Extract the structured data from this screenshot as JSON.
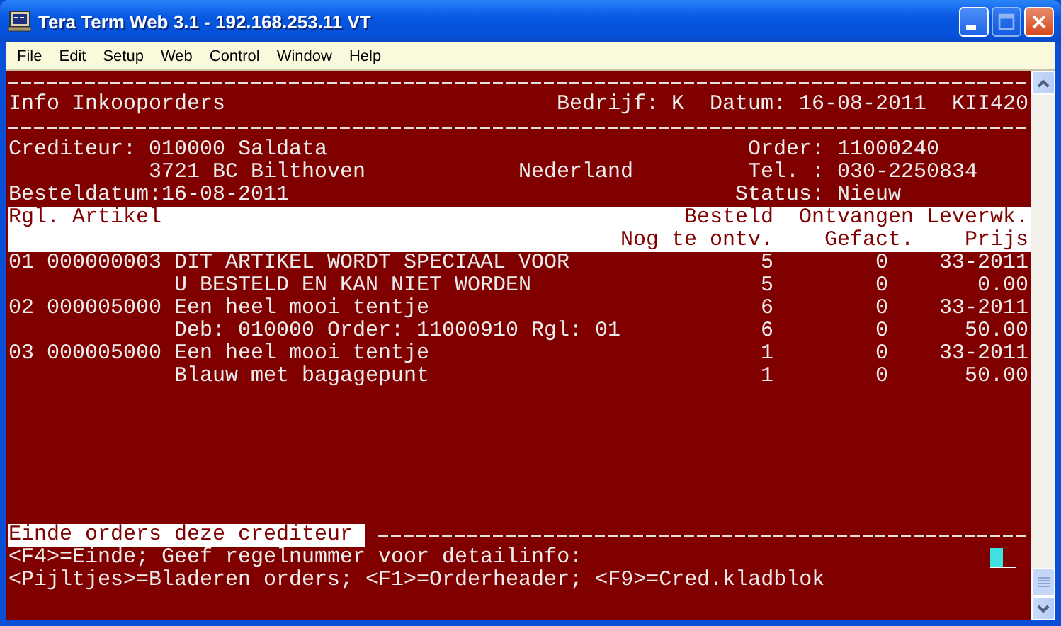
{
  "window": {
    "title": "Tera Term Web 3.1 - 192.168.253.11 VT"
  },
  "menu": [
    "File",
    "Edit",
    "Setup",
    "Web",
    "Control",
    "Window",
    "Help"
  ],
  "terminal": {
    "header": {
      "title": "Info Inkooporders",
      "company_label": "Bedrijf:",
      "company": "K",
      "date_label": "Datum:",
      "date": "16-08-2011",
      "program": "KII420"
    },
    "supplier": {
      "label": "Crediteur:",
      "name": "010000 Saldata",
      "address": "3721 BC Bilthoven",
      "country": "Nederland",
      "order_label": "Order:",
      "order": "11000240",
      "phone_label": "Tel. :",
      "phone": "030-2250834",
      "order_date_label": "Besteldatum:",
      "order_date": "16-08-2011",
      "status_label": "Status:",
      "status": "Nieuw"
    },
    "columns": {
      "line": "Rgl.",
      "article": "Artikel",
      "ordered": "Besteld",
      "received": "Ontvangen",
      "delivery_week": "Leverwk.",
      "outstanding": "Nog te ontv.",
      "invoiced": "Gefact.",
      "price": "Prijs"
    },
    "lines": [
      {
        "line": "01",
        "article": "000000003",
        "description": "DIT ARTIKEL WORDT SPECIAAL VOOR",
        "ordered": "5",
        "received": "0",
        "delivery_week": "33-2011",
        "description_2": "U BESTELD EN KAN NIET WORDEN",
        "outstanding": "5",
        "invoiced": "0",
        "price": "0.00"
      },
      {
        "line": "02",
        "article": "000005000",
        "description": "Een heel mooi tentje",
        "ordered": "6",
        "received": "0",
        "delivery_week": "33-2011",
        "description_2": "Deb: 010000 Order: 11000910 Rgl: 01",
        "outstanding": "6",
        "invoiced": "0",
        "price": "50.00"
      },
      {
        "line": "03",
        "article": "000005000",
        "description": "Een heel mooi tentje",
        "ordered": "1",
        "received": "0",
        "delivery_week": "33-2011",
        "description_2": "Blauw met bagagepunt",
        "outstanding": "1",
        "invoiced": "0",
        "price": "50.00"
      }
    ],
    "message": "Einde orders deze crediteur",
    "prompt": "<F4>=Einde; Geef regelnummer voor detailinfo:",
    "keys": "<Pijltjes>=Bladeren orders; <F1>=Orderheader; <F9>=Cred.kladblok"
  }
}
